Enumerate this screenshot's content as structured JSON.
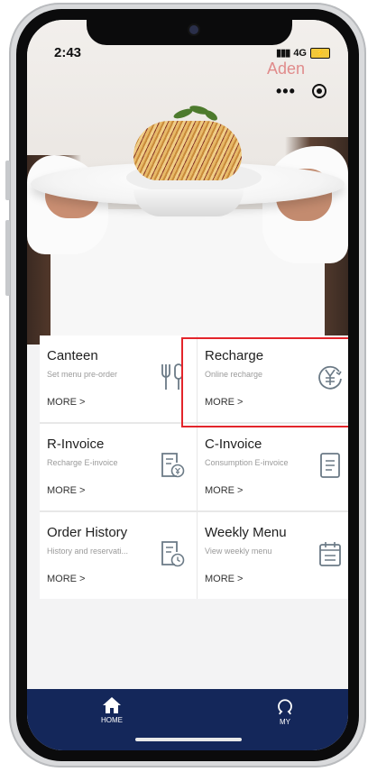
{
  "status_bar": {
    "time": "2:43",
    "network": "4G"
  },
  "hero": {
    "brand": "Aden"
  },
  "cards": [
    {
      "title": "Canteen",
      "subtitle": "Set menu pre-order",
      "more": "MORE >",
      "icon": "fork-knife-icon"
    },
    {
      "title": "Recharge",
      "subtitle": "Online recharge",
      "more": "MORE >",
      "icon": "yen-refresh-icon",
      "highlighted": true
    },
    {
      "title": "R-Invoice",
      "subtitle": "Recharge E-invoice",
      "more": "MORE >",
      "icon": "invoice-yen-icon"
    },
    {
      "title": "C-Invoice",
      "subtitle": "Consumption E-invoice",
      "more": "MORE >",
      "icon": "document-icon"
    },
    {
      "title": "Order History",
      "subtitle": "History and reservati...",
      "more": "MORE >",
      "icon": "document-clock-icon"
    },
    {
      "title": "Weekly Menu",
      "subtitle": "View weekly menu",
      "more": "MORE >",
      "icon": "calendar-icon"
    }
  ],
  "tabs": [
    {
      "label": "HOME",
      "icon": "home-icon"
    },
    {
      "label": "MY",
      "icon": "user-icon"
    }
  ],
  "colors": {
    "tabbar": "#14275a",
    "highlight": "#e3252b",
    "icon": "#6b7a86"
  }
}
